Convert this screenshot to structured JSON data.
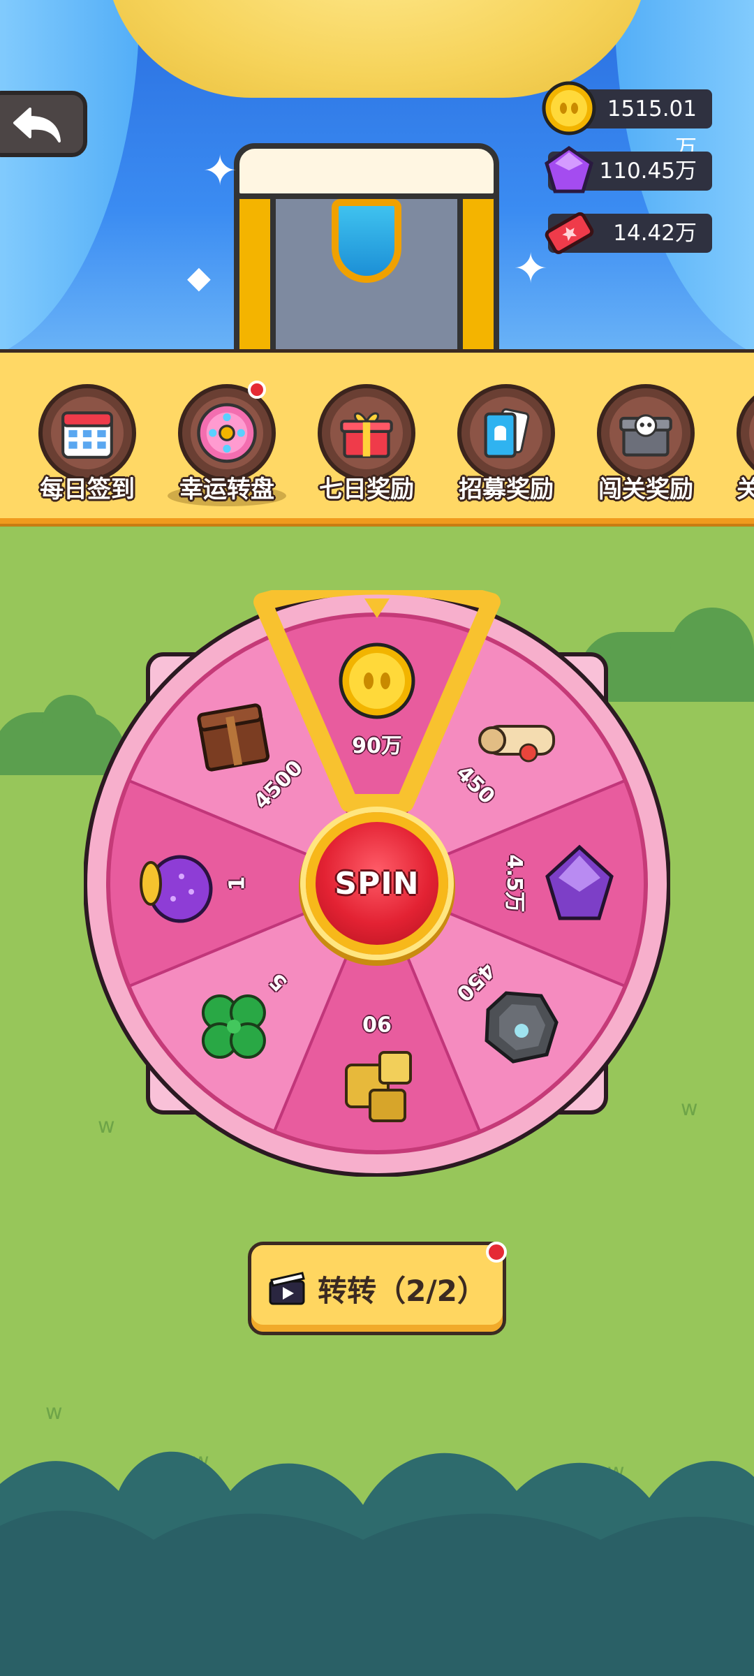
{
  "resources": {
    "coins": "1515.01万",
    "gems": "110.45万",
    "tickets": "14.42万"
  },
  "tabs": [
    {
      "label": "每日签到",
      "icon": "calendar-icon",
      "badge": false,
      "selected": false
    },
    {
      "label": "幸运转盘",
      "icon": "lucky-wheel-icon",
      "badge": true,
      "selected": true
    },
    {
      "label": "七日奖励",
      "icon": "gift-box-icon",
      "badge": false,
      "selected": false
    },
    {
      "label": "招募奖励",
      "icon": "recruit-cards-icon",
      "badge": false,
      "selected": false
    },
    {
      "label": "闯关奖励",
      "icon": "skull-chest-icon",
      "badge": false,
      "selected": false
    },
    {
      "label": "关",
      "icon": "partial-tab-icon",
      "badge": false,
      "selected": false
    }
  ],
  "wheel": {
    "center_label": "SPIN",
    "prizes": [
      {
        "icon": "gold-coin-icon",
        "amount": "90万"
      },
      {
        "icon": "scroll-icon",
        "amount": "450"
      },
      {
        "icon": "purple-gem-icon",
        "amount": "4.5万"
      },
      {
        "icon": "grey-stone-icon",
        "amount": "450"
      },
      {
        "icon": "golden-dice-icon",
        "amount": "90"
      },
      {
        "icon": "clover-icon",
        "amount": "5"
      },
      {
        "icon": "purple-pouch-icon",
        "amount": "1"
      },
      {
        "icon": "treasure-chest-icon",
        "amount": "4500"
      }
    ]
  },
  "spin_action": {
    "label": "转转（2/2）",
    "icon": "video-ad-icon",
    "badge": true
  },
  "colors": {
    "wheel_pink": "#e85c9e",
    "wheel_light": "#f58bbf",
    "wheel_rim": "#f9b8d2",
    "pointer_gold": "#f9c531",
    "tabbar_yellow": "#ffd865",
    "field_green": "#97c65a"
  }
}
